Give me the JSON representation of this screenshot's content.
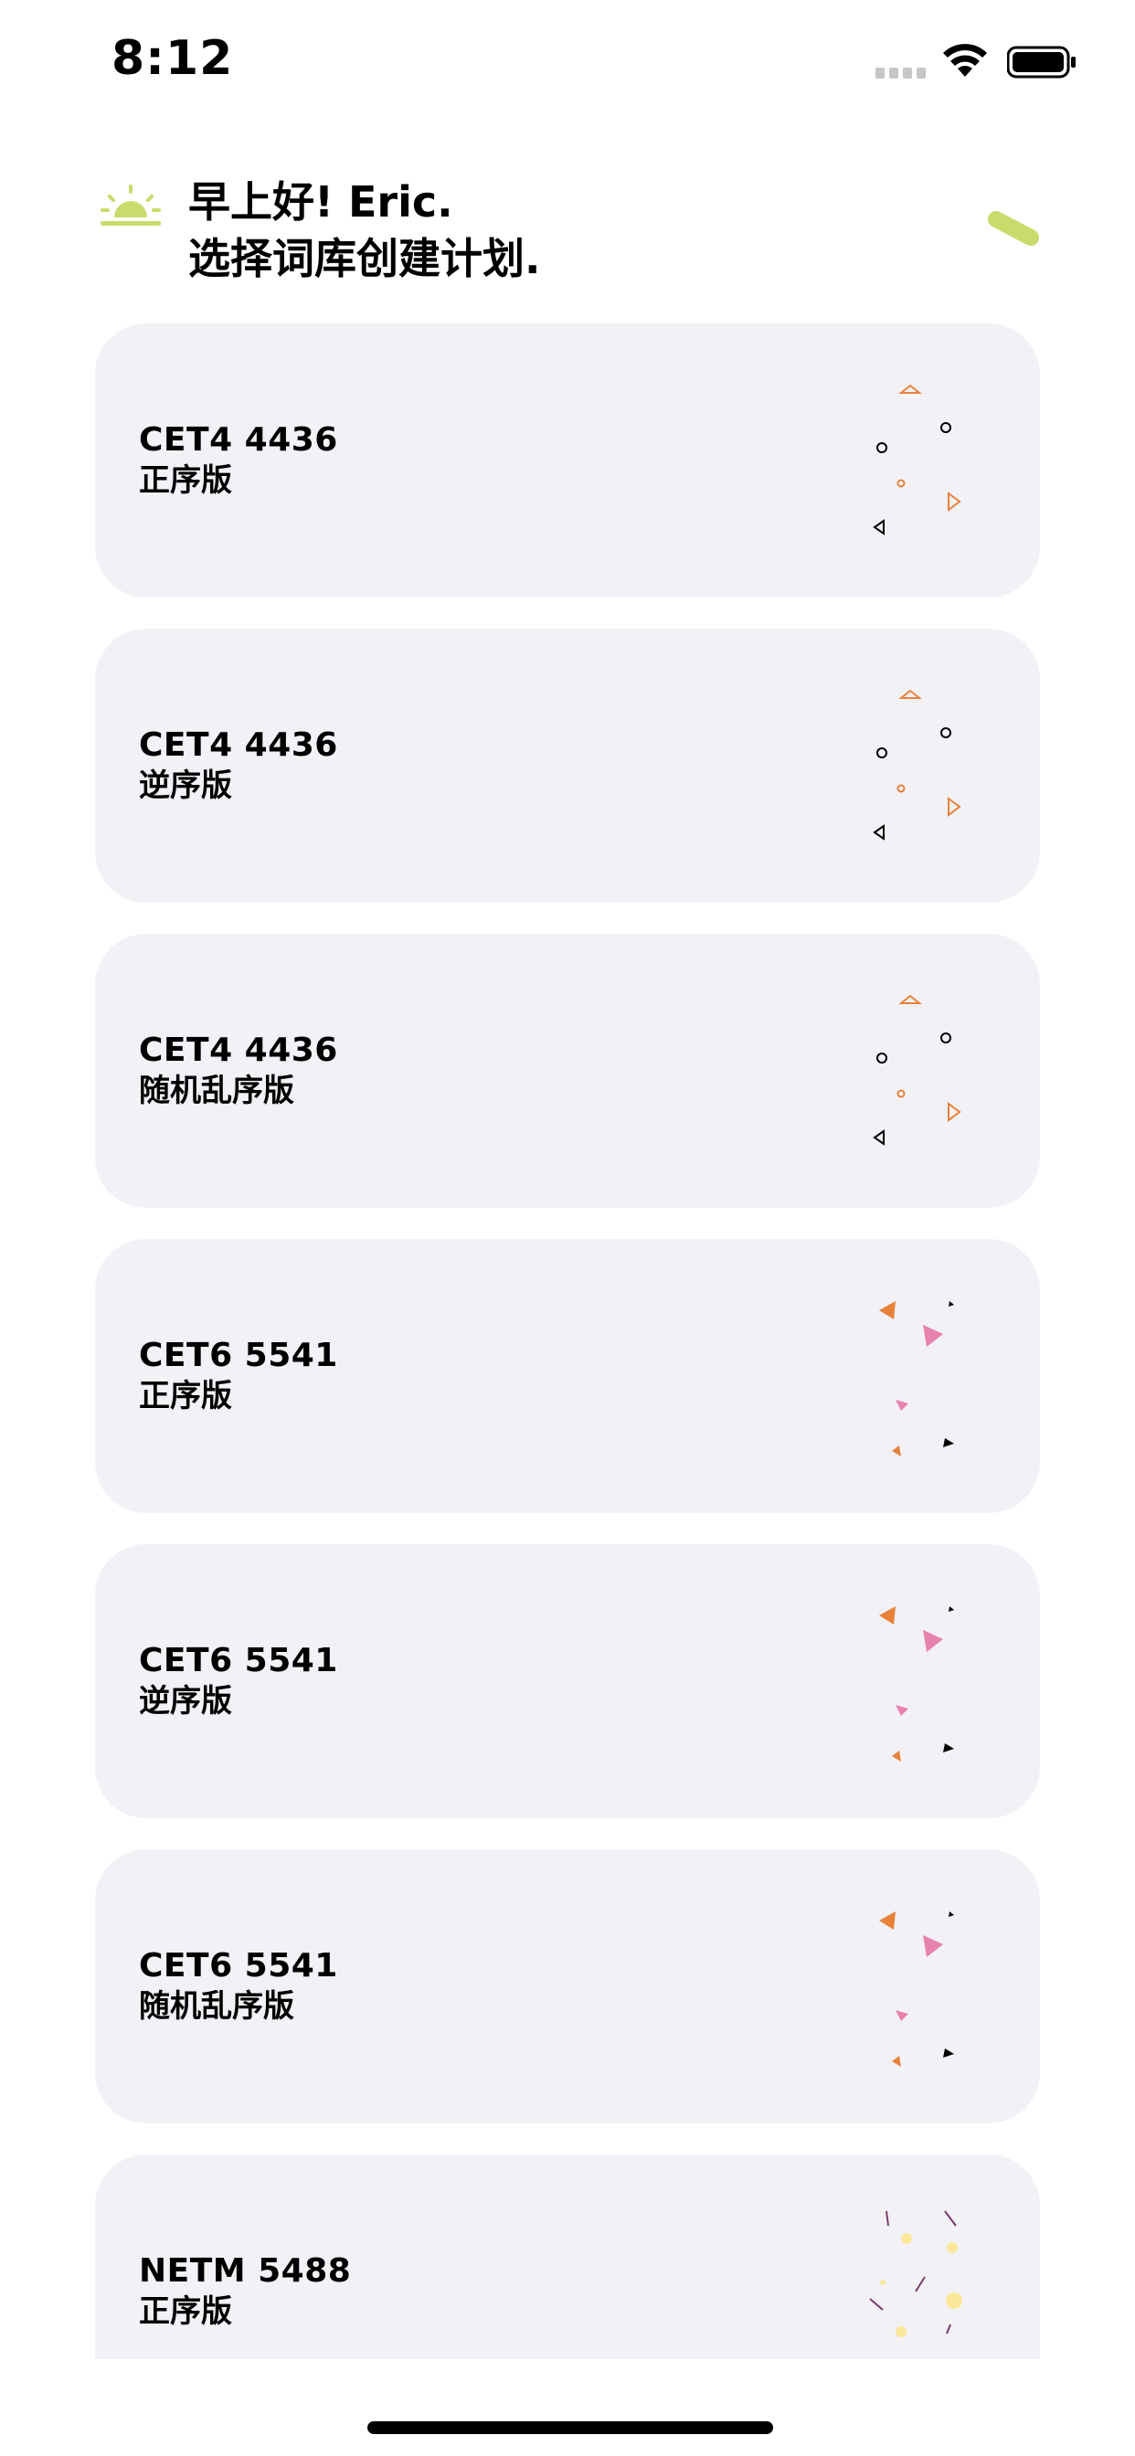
{
  "status_bar": {
    "time": "8:12",
    "icons": [
      "cellular-signal-icon",
      "wifi-icon",
      "battery-icon"
    ]
  },
  "header": {
    "greeting_line1": "早上好! Eric.",
    "greeting_line2": "选择词库创建计划.",
    "icons": [
      "sun-icon",
      "pill-icon"
    ]
  },
  "colors": {
    "card_bg": "#f2f1f6",
    "accent_green": "#c8dc6c",
    "orange": "#e8823a",
    "pink": "#e882ae",
    "yellow": "#fbe79a",
    "purple": "#7a3a6a"
  },
  "cards": [
    {
      "title": "CET4 4436",
      "subtitle": "正序版",
      "deco": "outline-shapes"
    },
    {
      "title": "CET4 4436",
      "subtitle": "逆序版",
      "deco": "outline-shapes"
    },
    {
      "title": "CET4 4436",
      "subtitle": "随机乱序版",
      "deco": "outline-shapes"
    },
    {
      "title": "CET6 5541",
      "subtitle": "正序版",
      "deco": "filled-triangles"
    },
    {
      "title": "CET6 5541",
      "subtitle": "逆序版",
      "deco": "filled-triangles"
    },
    {
      "title": "CET6 5541",
      "subtitle": "随机乱序版",
      "deco": "filled-triangles"
    },
    {
      "title": "NETM 5488",
      "subtitle": "正序版",
      "deco": "dots-and-lines"
    }
  ]
}
